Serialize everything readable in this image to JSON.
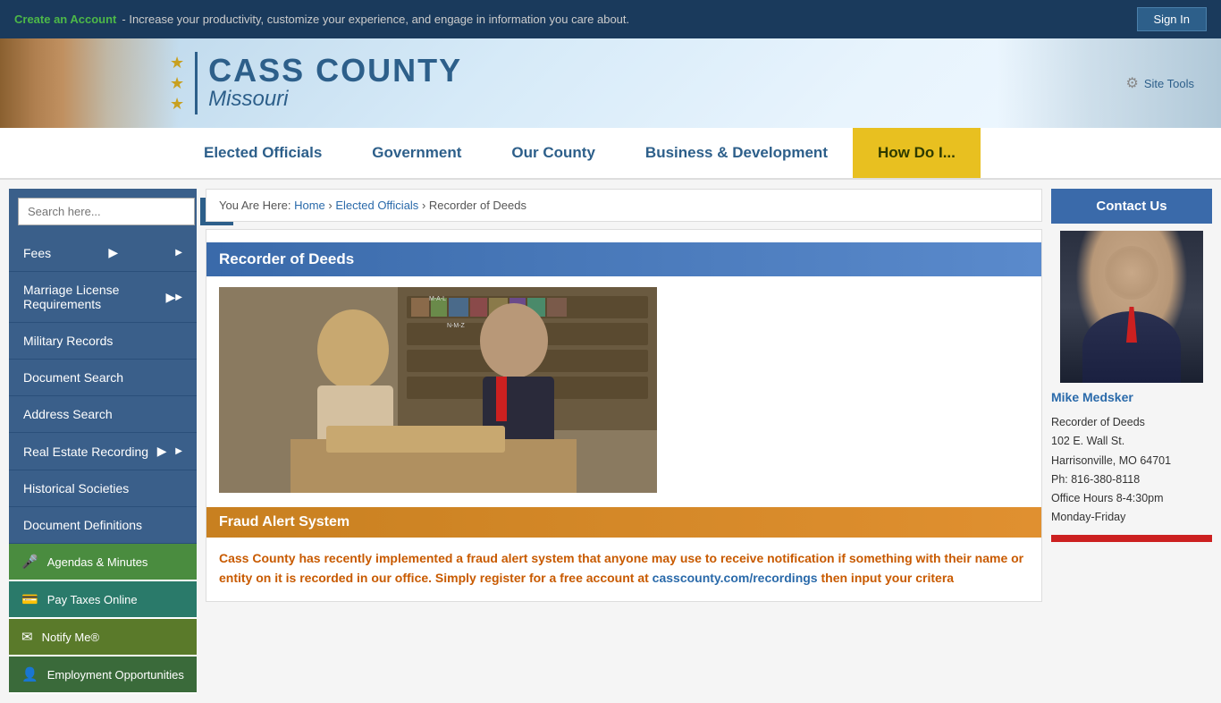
{
  "topbar": {
    "create_account_text": "Create an Account",
    "tagline": " - Increase your productivity, customize your experience, and engage in information you care about.",
    "sign_in": "Sign In"
  },
  "header": {
    "county_name": "CASS COUNTY",
    "state_name": "Missouri",
    "site_tools": "Site Tools"
  },
  "nav": {
    "items": [
      {
        "label": "Elected Officials",
        "id": "elected-officials"
      },
      {
        "label": "Government",
        "id": "government"
      },
      {
        "label": "Our County",
        "id": "our-county"
      },
      {
        "label": "Business & Development",
        "id": "business-development"
      },
      {
        "label": "How Do I...",
        "id": "how-do-i",
        "highlight": true
      }
    ]
  },
  "sidebar": {
    "search_placeholder": "Search here...",
    "search_button_icon": "🔍",
    "menu_items": [
      {
        "label": "Fees",
        "has_arrow": true
      },
      {
        "label": "Marriage License Requirements",
        "has_arrow": true
      },
      {
        "label": "Military Records",
        "has_arrow": false
      },
      {
        "label": "Document Search",
        "has_arrow": false
      },
      {
        "label": "Address Search",
        "has_arrow": false
      },
      {
        "label": "Real Estate Recording",
        "has_arrow": true
      },
      {
        "label": "Historical Societies",
        "has_arrow": false
      },
      {
        "label": "Document Definitions",
        "has_arrow": false
      }
    ],
    "quick_links": [
      {
        "label": "Agendas & Minutes",
        "icon": "🎤",
        "color": "green"
      },
      {
        "label": "Pay Taxes Online",
        "icon": "💳",
        "color": "teal"
      },
      {
        "label": "Notify Me®",
        "icon": "✉",
        "color": "olive"
      },
      {
        "label": "Employment Opportunities",
        "icon": "👤",
        "color": "darkgreen"
      }
    ]
  },
  "breadcrumb": {
    "you_are_here": "You Are Here: ",
    "home": "Home",
    "elected_officials": "Elected Officials",
    "current": "Recorder of Deeds"
  },
  "main": {
    "page_title": "Recorder of Deeds",
    "fraud_alert_title": "Fraud Alert System",
    "fraud_text": "Cass County has recently implemented a fraud alert system that anyone may use to receive notification if something with their name or entity on it is recorded in our office.  Simply register for a free account at ",
    "fraud_link_text": "casscounty.com/recordings",
    "fraud_link_url": "casscounty.com/recordings",
    "fraud_text2": " then input your critera"
  },
  "contact": {
    "title": "Contact Us",
    "name": "Mike Medsker",
    "title_role": "Recorder of Deeds",
    "address1": "102 E. Wall St.",
    "address2": "Harrisonville, MO 64701",
    "phone": "Ph: 816-380-8118",
    "hours": " Office Hours 8-4:30pm",
    "days": "Monday-Friday"
  }
}
